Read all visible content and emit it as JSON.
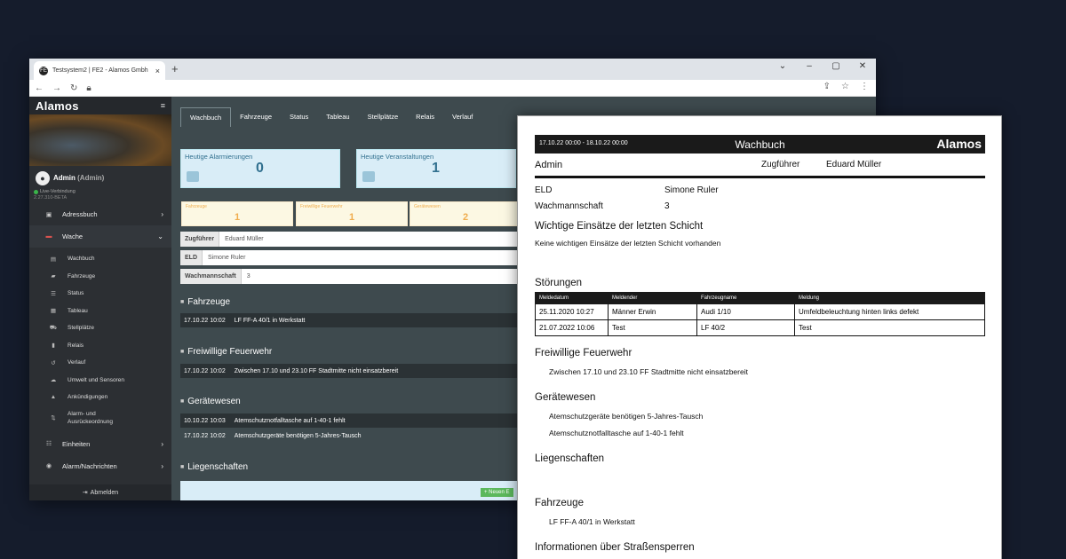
{
  "browser": {
    "tab_title": "Testsystem2 | FE2 - Alamos Gmbh",
    "tab_icon": "alamos-favicon-icon",
    "new_tab": "+",
    "controls": [
      "⌄",
      "–",
      "▢",
      "✕"
    ]
  },
  "sidebar": {
    "logo": "Alamos",
    "user": "Admin",
    "user_suffix": "(Admin)",
    "status": "Live-Verbindung",
    "version": "2.27.310-BETA",
    "items": [
      {
        "label": "Adressbuch",
        "icon": "address-book-icon"
      },
      {
        "label": "Wache",
        "icon": "fire-truck-icon"
      }
    ],
    "subitems": [
      {
        "label": "Wachbuch",
        "icon": "book-icon"
      },
      {
        "label": "Fahrzeuge",
        "icon": "truck-icon"
      },
      {
        "label": "Status",
        "icon": "list-icon"
      },
      {
        "label": "Tableau",
        "icon": "tableau-icon"
      },
      {
        "label": "Stellplätze",
        "icon": "parking-icon"
      },
      {
        "label": "Relais",
        "icon": "relay-icon"
      },
      {
        "label": "Verlauf",
        "icon": "history-icon"
      },
      {
        "label": "Umwelt und Sensoren",
        "icon": "sensor-icon"
      },
      {
        "label": "Ankündigungen",
        "icon": "bell-icon"
      },
      {
        "label": "Alarm- und Ausrückeordnung",
        "icon": "sort-icon"
      }
    ],
    "items2": [
      {
        "label": "Einheiten",
        "icon": "units-icon"
      },
      {
        "label": "Alarm/Nachrichten",
        "icon": "alarm-icon"
      }
    ],
    "logout": "Abmelden"
  },
  "main": {
    "tabs": [
      "Wachbuch",
      "Fahrzeuge",
      "Status",
      "Tableau",
      "Stellplätze",
      "Relais",
      "Verlauf"
    ],
    "cards": [
      {
        "title": "Heutige Alarmierungen",
        "value": "0"
      },
      {
        "title": "Heutige Veranstaltungen",
        "value": "1"
      }
    ],
    "small_cards": [
      {
        "title": "Fahrzeuge",
        "value": "1"
      },
      {
        "title": "Freiwillige Feuerwehr",
        "value": "1"
      },
      {
        "title": "Gerätewesen",
        "value": "2"
      }
    ],
    "fields": [
      {
        "label": "Zugführer",
        "value": "Eduard Müller"
      },
      {
        "label": "ELD",
        "value": "Simone Ruler"
      },
      {
        "label": "Wachmannschaft",
        "value": "3"
      }
    ],
    "sections": {
      "fahrzeuge": {
        "title": "Fahrzeuge",
        "rows": [
          {
            "date": "17.10.22 10:02",
            "text": "LF FF-A 40/1 in Werkstatt"
          }
        ]
      },
      "ff": {
        "title": "Freiwillige Feuerwehr",
        "rows": [
          {
            "date": "17.10.22 10:02",
            "text": "Zwischen 17.10 und 23.10 FF Stadtmitte nicht einsatzbereit"
          }
        ]
      },
      "geraete": {
        "title": "Gerätewesen",
        "rows": [
          {
            "date": "10.10.22 10:03",
            "text": "Atemschutznotfalltasche auf 1-40-1 fehlt"
          },
          {
            "date": "17.10.22 10:02",
            "text": "Atemschutzgeräte benötigen 5-Jahres-Tausch"
          }
        ]
      },
      "liegenschaften": {
        "title": "Liegenschaften"
      }
    },
    "new_button": "+ Neuen E"
  },
  "report": {
    "daterange": "17.10.22 00:00 - 18.10.22 00:00",
    "title": "Wachbuch",
    "logo": "Alamos",
    "user": "Admin",
    "zf_label": "Zugführer",
    "zf_value": "Eduard Müller",
    "eld_label": "ELD",
    "eld_value": "Simone Ruler",
    "wm_label": "Wachmannschaft",
    "wm_value": "3",
    "wichtig_title": "Wichtige Einsätze der letzten Schicht",
    "wichtig_text": "Keine wichtigen Einsätze der letzten Schicht vorhanden",
    "stoer_title": "Störungen",
    "stoer_headers": [
      "Meldedatum",
      "Meldender",
      "Fahrzeugname",
      "Meldung"
    ],
    "stoer_rows": [
      [
        "25.11.2020 10:27",
        "Männer Erwin",
        "Audi 1/10",
        "Umfeldbeleuchtung hinten links defekt"
      ],
      [
        "21.07.2022 10:06",
        "Test",
        "LF 40/2",
        "Test"
      ]
    ],
    "ff_title": "Freiwillige Feuerwehr",
    "ff_text": "Zwischen 17.10 und 23.10 FF Stadtmitte nicht einsatzbereit",
    "gw_title": "Gerätewesen",
    "gw_items": [
      "Atemschutzgeräte benötigen 5-Jahres-Tausch",
      "Atemschutznotfalltasche auf 1-40-1 fehlt"
    ],
    "lg_title": "Liegenschaften",
    "fz_title": "Fahrzeuge",
    "fz_text": "LF FF-A 40/1 in Werkstatt",
    "info_title": "Informationen über Straßensperren"
  }
}
